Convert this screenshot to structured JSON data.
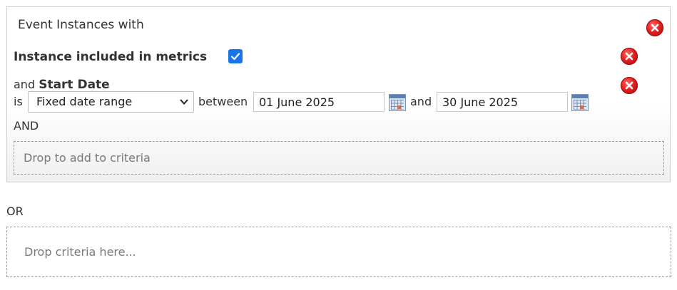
{
  "group": {
    "title": "Event Instances with",
    "criteria": [
      {
        "label": "Instance included in metrics",
        "checked": true
      },
      {
        "prefix": "and",
        "label": "Start Date",
        "is_label": "is",
        "operator": "Fixed date range",
        "between_label": "between",
        "from_date": "01 June 2025",
        "and_label": "and",
        "to_date": "30 June 2025"
      }
    ],
    "and_label": "AND",
    "drop_text": "Drop to add to criteria"
  },
  "or_label": "OR",
  "or_drop_text": "Drop criteria here...",
  "icons": {
    "remove": "remove-circle-icon",
    "calendar": "calendar-icon",
    "dropdown": "chevron-down-icon",
    "check": "checkmark-icon"
  },
  "colors": {
    "remove_red": "#e02020",
    "checkbox_blue": "#1a73e8",
    "border": "#cfcfcf"
  }
}
